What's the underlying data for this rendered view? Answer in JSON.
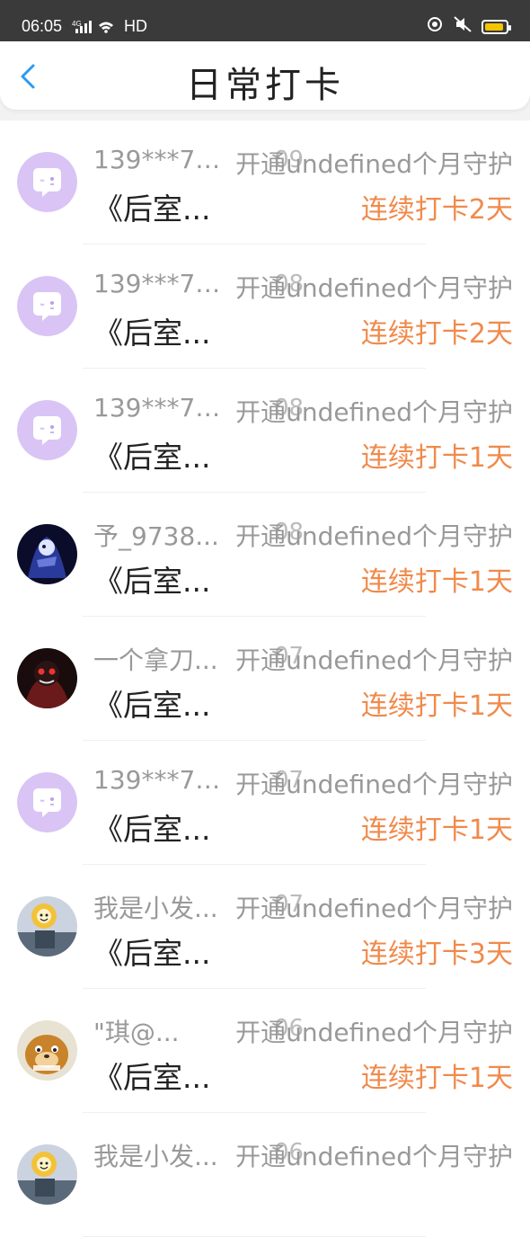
{
  "status_bar": {
    "time": "06:05",
    "network": "4G",
    "hd": "HD"
  },
  "header": {
    "title": "日常打卡"
  },
  "rows": [
    {
      "name": "139***70...",
      "time": "09",
      "action": "开通undefined个月守护",
      "book": "《后室...",
      "streak": "连续打卡2天",
      "avatar": "chat-bubble"
    },
    {
      "name": "139***70...",
      "time": "08",
      "action": "开通undefined个月守护",
      "book": "《后室...",
      "streak": "连续打卡2天",
      "avatar": "chat-bubble"
    },
    {
      "name": "139***70...",
      "time": "08",
      "action": "开通undefined个月守护",
      "book": "《后室...",
      "streak": "连续打卡1天",
      "avatar": "chat-bubble"
    },
    {
      "name": "予_9738...",
      "time": "08",
      "action": "开通undefined个月守护",
      "book": "《后室...",
      "streak": "连续打卡1天",
      "avatar": "photo-dark-blue"
    },
    {
      "name": "一个拿刀...",
      "time": "07",
      "action": "开通undefined个月守护",
      "book": "《后室...",
      "streak": "连续打卡1天",
      "avatar": "photo-dark-red"
    },
    {
      "name": "139***70...",
      "time": "07",
      "action": "开通undefined个月守护",
      "book": "《后室...",
      "streak": "连续打卡1天",
      "avatar": "chat-bubble"
    },
    {
      "name": "我是小发...",
      "time": "07",
      "action": "开通undefined个月守护",
      "book": "《后室...",
      "streak": "连续打卡3天",
      "avatar": "photo-cartoon-flower"
    },
    {
      "name": "\"琪@...",
      "time": "06",
      "action": "开通undefined个月守护",
      "book": "《后室...",
      "streak": "连续打卡1天",
      "avatar": "photo-cartoon-bear"
    },
    {
      "name": "我是小发...",
      "time": "06",
      "action": "开通undefined个月守护",
      "book": "",
      "streak": "",
      "avatar": "photo-cartoon-flower"
    }
  ],
  "colors": {
    "streak": "#f08a4b",
    "accent": "#2a9bf0",
    "avatar_default": "#d9c4f5"
  }
}
